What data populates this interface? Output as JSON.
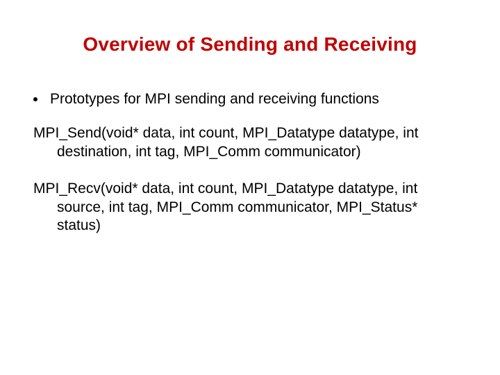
{
  "title": "Overview of Sending and Receiving",
  "bullet1": "Prototypes for MPI sending and receiving functions",
  "send": {
    "line1": "MPI_Send(void* data, int count, MPI_Datatype datatype, int",
    "line2": "destination, int tag, MPI_Comm communicator)"
  },
  "recv": {
    "line1": "MPI_Recv(void* data, int count, MPI_Datatype datatype, int",
    "line2": "source, int tag, MPI_Comm communicator, MPI_Status*",
    "line3": "status)"
  }
}
